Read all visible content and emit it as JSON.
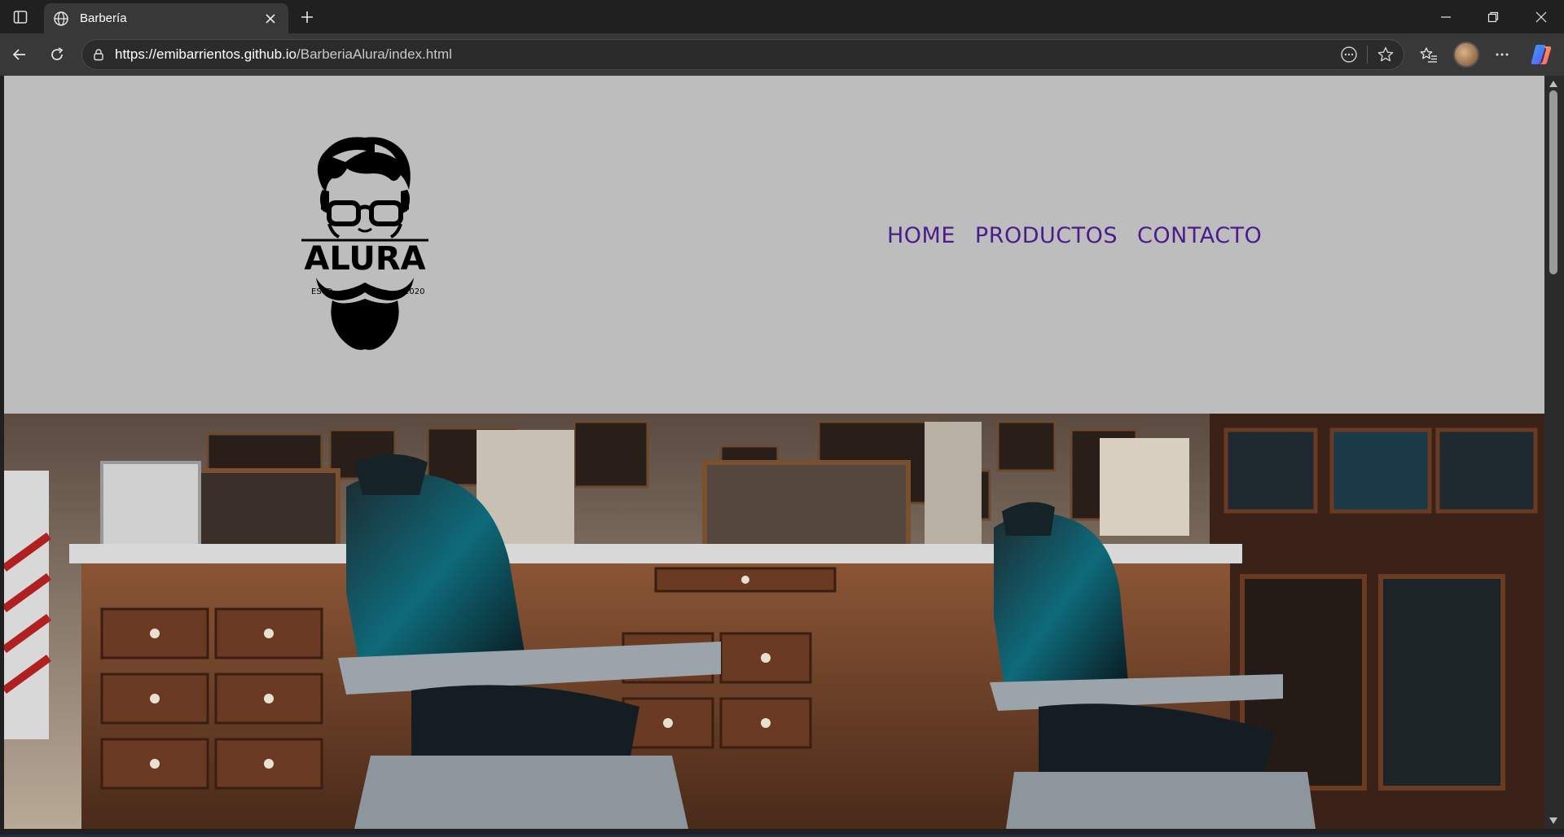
{
  "browser": {
    "tab": {
      "title": "Barbería",
      "favicon": "globe-icon"
    },
    "url": {
      "host": "https://emibarrientos.github.io",
      "path": "/BarberiaAlura/index.html"
    },
    "colors": {
      "chrome_bg": "#202020",
      "toolbar_bg": "#383838",
      "omnibox_bg": "#2b2b2b"
    }
  },
  "page": {
    "logo": {
      "brand": "ALURA",
      "left_tag": "ESTD",
      "right_tag": "2020"
    },
    "nav": {
      "items": [
        "HOME",
        "PRODUCTOS",
        "CONTACTO"
      ]
    },
    "hero": {
      "image": "barbershop-interior-photo"
    },
    "colors": {
      "header_bg": "#bdbdbd",
      "nav_link": "#4b1c8c"
    }
  }
}
